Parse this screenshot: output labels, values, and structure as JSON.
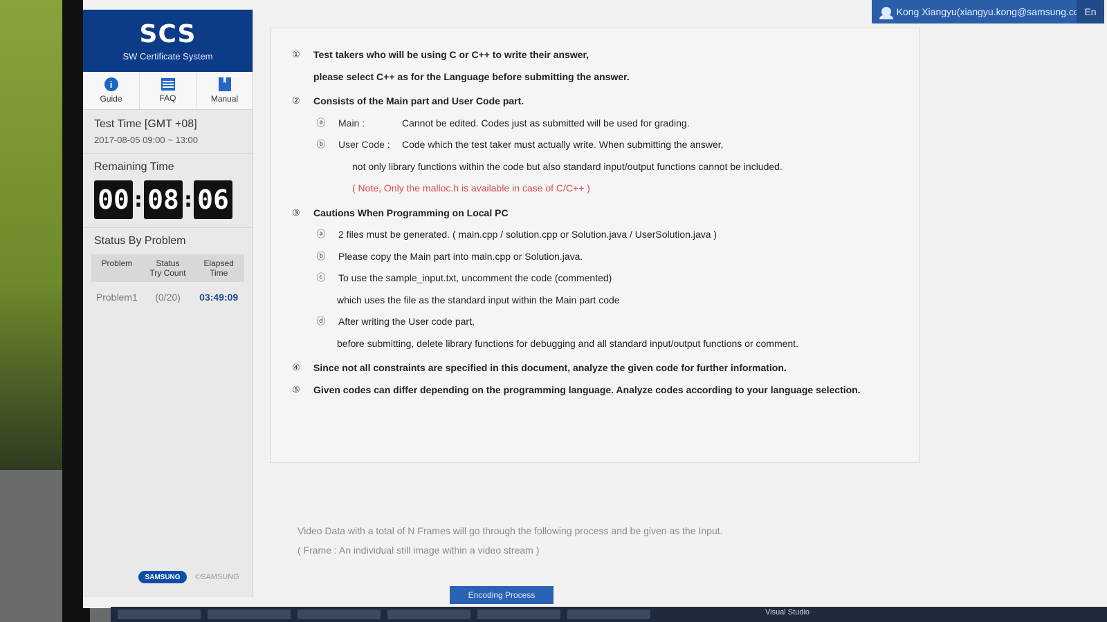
{
  "header": {
    "user": "Kong Xiangyu(xiangyu.kong@samsung.com)",
    "lang_tab": "En"
  },
  "sidebar": {
    "logo": {
      "title": "SCS",
      "subtitle": "SW Certificate System"
    },
    "tiles": [
      {
        "label": "Guide",
        "icon": "info-icon"
      },
      {
        "label": "FAQ",
        "icon": "faq-icon"
      },
      {
        "label": "Manual",
        "icon": "book-icon"
      }
    ],
    "test_time": {
      "title": "Test Time [GMT +08]",
      "range": "2017-08-05 09:00 ~ 13:00"
    },
    "remaining": {
      "title": "Remaining Time",
      "hh": "00",
      "mm": "08",
      "ss": "06"
    },
    "status": {
      "title": "Status By Problem",
      "headers": [
        "Problem",
        "Status\nTry Count",
        "Elapsed\nTime"
      ],
      "row": {
        "problem": "Problem1",
        "try_count": "(0/20)",
        "elapsed": "03:49:09"
      }
    },
    "brand": {
      "logo_text": "SAMSUNG",
      "copyright": "©SAMSUNG"
    }
  },
  "content": {
    "items": [
      {
        "marker": "①",
        "bold": true,
        "text": "Test takers who will be using C or C++ to write their answer,"
      },
      {
        "marker": "",
        "bold": true,
        "text": "please select C++ as for the Language before submitting the answer."
      },
      {
        "marker": "②",
        "bold": true,
        "text": "Consists of the Main part and User Code part."
      },
      {
        "marker": "ⓐ",
        "label": "Main :",
        "text": "Cannot be edited. Codes just as submitted will be used for grading."
      },
      {
        "marker": "ⓑ",
        "label": "User Code :",
        "text": "Code which the test taker must actually write. When submitting the answer,"
      },
      {
        "marker": "",
        "text": "not only library functions within the code but also standard input/output functions cannot be included."
      },
      {
        "marker": "",
        "note": "( Note, Only the malloc.h is available in case of C/C++ )"
      },
      {
        "marker": "③",
        "bold": false,
        "text": "Cautions When Programming on Local PC"
      },
      {
        "marker": "ⓐ",
        "text": "2 files must be generated. ( main.cpp / solution.cpp or Solution.java / UserSolution.java )"
      },
      {
        "marker": "ⓑ",
        "text": "Please copy the Main part into main.cpp or Solution.java."
      },
      {
        "marker": "ⓒ",
        "text": "To use the sample_input.txt, uncomment the code (commented)"
      },
      {
        "marker": "",
        "text": "which uses the file as the standard input within the Main part code"
      },
      {
        "marker": "ⓓ",
        "text": "After writing the User code part,"
      },
      {
        "marker": "",
        "text": "before submitting, delete library functions for debugging and all standard input/output functions or comment."
      },
      {
        "marker": "④",
        "bold": true,
        "text": "Since not all constraints are specified in this document, analyze the given code for further information."
      },
      {
        "marker": "⑤",
        "bold": true,
        "text": "Given codes can differ depending on the programming language. Analyze codes according to your language selection."
      }
    ],
    "bottom": {
      "line1": "Video Data with a total of N Frames will go through the following process and be given as the Input.",
      "line2": "( Frame : An individual still image within a video stream )",
      "tab": "Encoding Process"
    }
  },
  "taskbar": {
    "right_label": "Visual Studio"
  }
}
